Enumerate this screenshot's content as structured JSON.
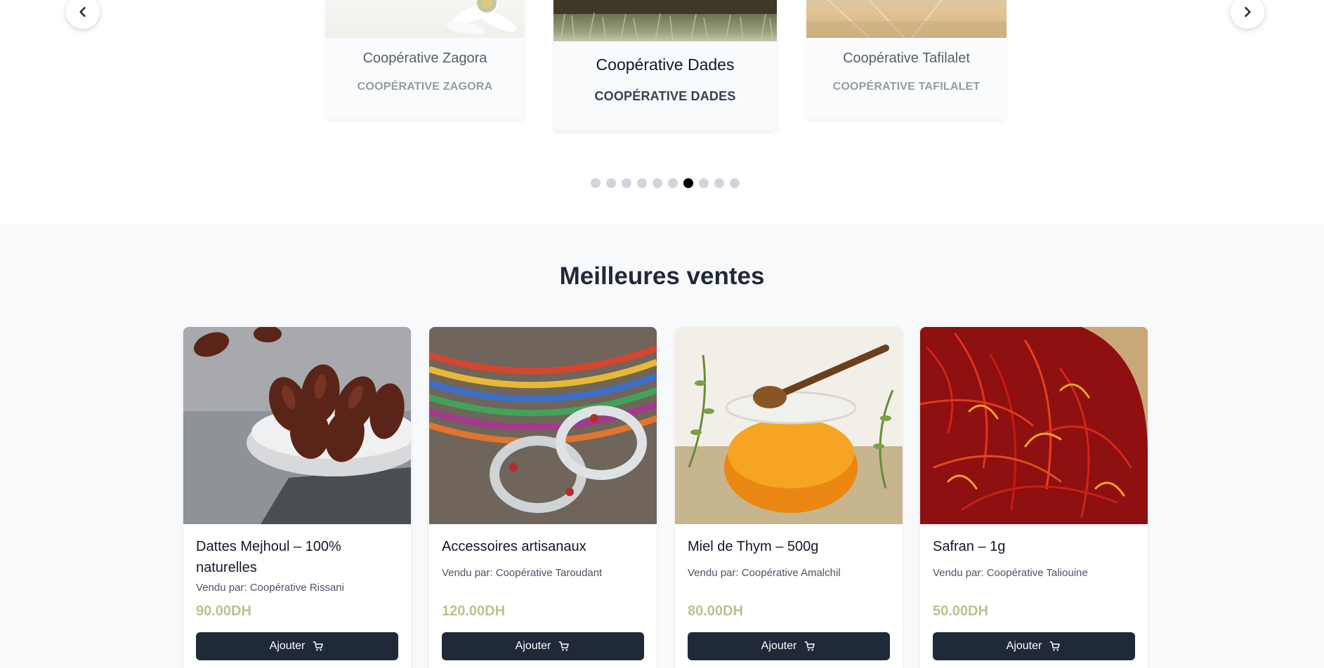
{
  "carousel": {
    "prev_icon": "chevron-left-icon",
    "next_icon": "chevron-right-icon",
    "cards": [
      {
        "name": "Coopérative Zagora",
        "subtitle": "COOPÉRATIVE ZAGORA"
      },
      {
        "name": "Coopérative Dades",
        "subtitle": "COOPÉRATIVE DADES"
      },
      {
        "name": "Coopérative Tafilalet",
        "subtitle": "COOPÉRATIVE TAFILALET"
      }
    ],
    "dots_total": 10,
    "active_dot": 7
  },
  "best_sellers": {
    "title": "Meilleures ventes",
    "products": [
      {
        "name": "Dattes Mejhoul – 100% naturelles",
        "seller": "Vendu par: Coopérative Rissani",
        "price": "90.00DH",
        "button": "Ajouter"
      },
      {
        "name": "Accessoires artisanaux",
        "seller": "Vendu par: Coopérative Taroudant",
        "price": "120.00DH",
        "button": "Ajouter"
      },
      {
        "name": "Miel de Thym – 500g",
        "seller": "Vendu par: Coopérative Amalchil",
        "price": "80.00DH",
        "button": "Ajouter"
      },
      {
        "name": "Safran – 1g",
        "seller": "Vendu par: Coopérative Taliouine",
        "price": "50.00DH",
        "button": "Ajouter"
      }
    ]
  },
  "colors": {
    "primary_button": "#1f2937",
    "price": "#b7c48d",
    "active_dot": "#000000",
    "inactive_dot": "#d1d5db"
  }
}
